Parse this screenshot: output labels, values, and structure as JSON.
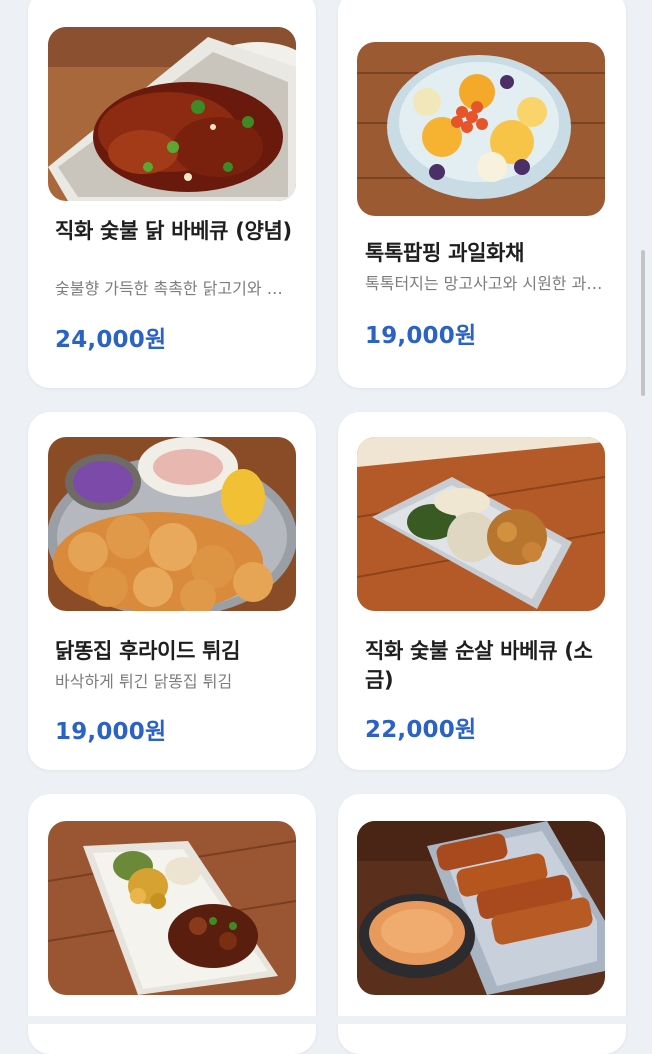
{
  "menu": {
    "items": [
      {
        "title": "직화 숯불 닭 바베큐 (양념)",
        "desc": "숯불향 가득한 촉촉한 닭고기와 특제 양념",
        "price": "24,000원"
      },
      {
        "title": "톡톡팝핑 과일화채",
        "desc": "톡톡터지는 망고사고와 시원한 과일화채",
        "price": "19,000원"
      },
      {
        "title": "닭똥집 후라이드 튀김",
        "desc": "바삭하게 튀긴 닭똥집 튀김",
        "price": "19,000원"
      },
      {
        "title": "직화 숯불 순살 바베큐 (소금)",
        "desc": "",
        "price": "22,000원"
      },
      {
        "title": "",
        "desc": "",
        "price": ""
      },
      {
        "title": "",
        "desc": "",
        "price": ""
      }
    ]
  },
  "colors": {
    "price": "#2a62c5",
    "background": "#edf0f4",
    "card": "#ffffff"
  }
}
